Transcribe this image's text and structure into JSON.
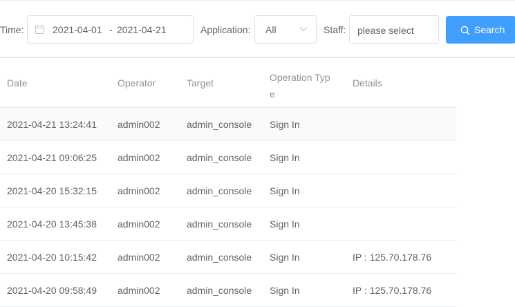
{
  "filters": {
    "time_label": "Time:",
    "date_start": "2021-04-01",
    "date_separator": "-",
    "date_end": "2021-04-21",
    "application_label": "Application:",
    "application_value": "All",
    "staff_label": "Staff:",
    "staff_placeholder": "please select",
    "search_label": "Search"
  },
  "colors": {
    "primary": "#409eff",
    "border": "#dcdfe6",
    "header_text": "#909399",
    "body_text": "#606266",
    "stripe": "#fafafa"
  },
  "icons": {
    "date": "calendar-icon",
    "application": "chevron-down-icon",
    "search": "search-icon"
  },
  "table": {
    "columns": [
      "Date",
      "Operator",
      "Target",
      "Operation Type",
      "Details"
    ],
    "rows": [
      [
        "2021-04-21 13:24:41",
        "admin002",
        "admin_console",
        "Sign In",
        ""
      ],
      [
        "2021-04-21 09:06:25",
        "admin002",
        "admin_console",
        "Sign In",
        ""
      ],
      [
        "2021-04-20 15:32:15",
        "admin002",
        "admin_console",
        "Sign In",
        ""
      ],
      [
        "2021-04-20 13:45:38",
        "admin002",
        "admin_console",
        "Sign In",
        ""
      ],
      [
        "2021-04-20 10:15:42",
        "admin002",
        "admin_console",
        "Sign In",
        "IP : 125.70.178.76"
      ],
      [
        "2021-04-20 09:58:49",
        "admin002",
        "admin_console",
        "Sign In",
        "IP : 125.70.178.76"
      ]
    ]
  }
}
